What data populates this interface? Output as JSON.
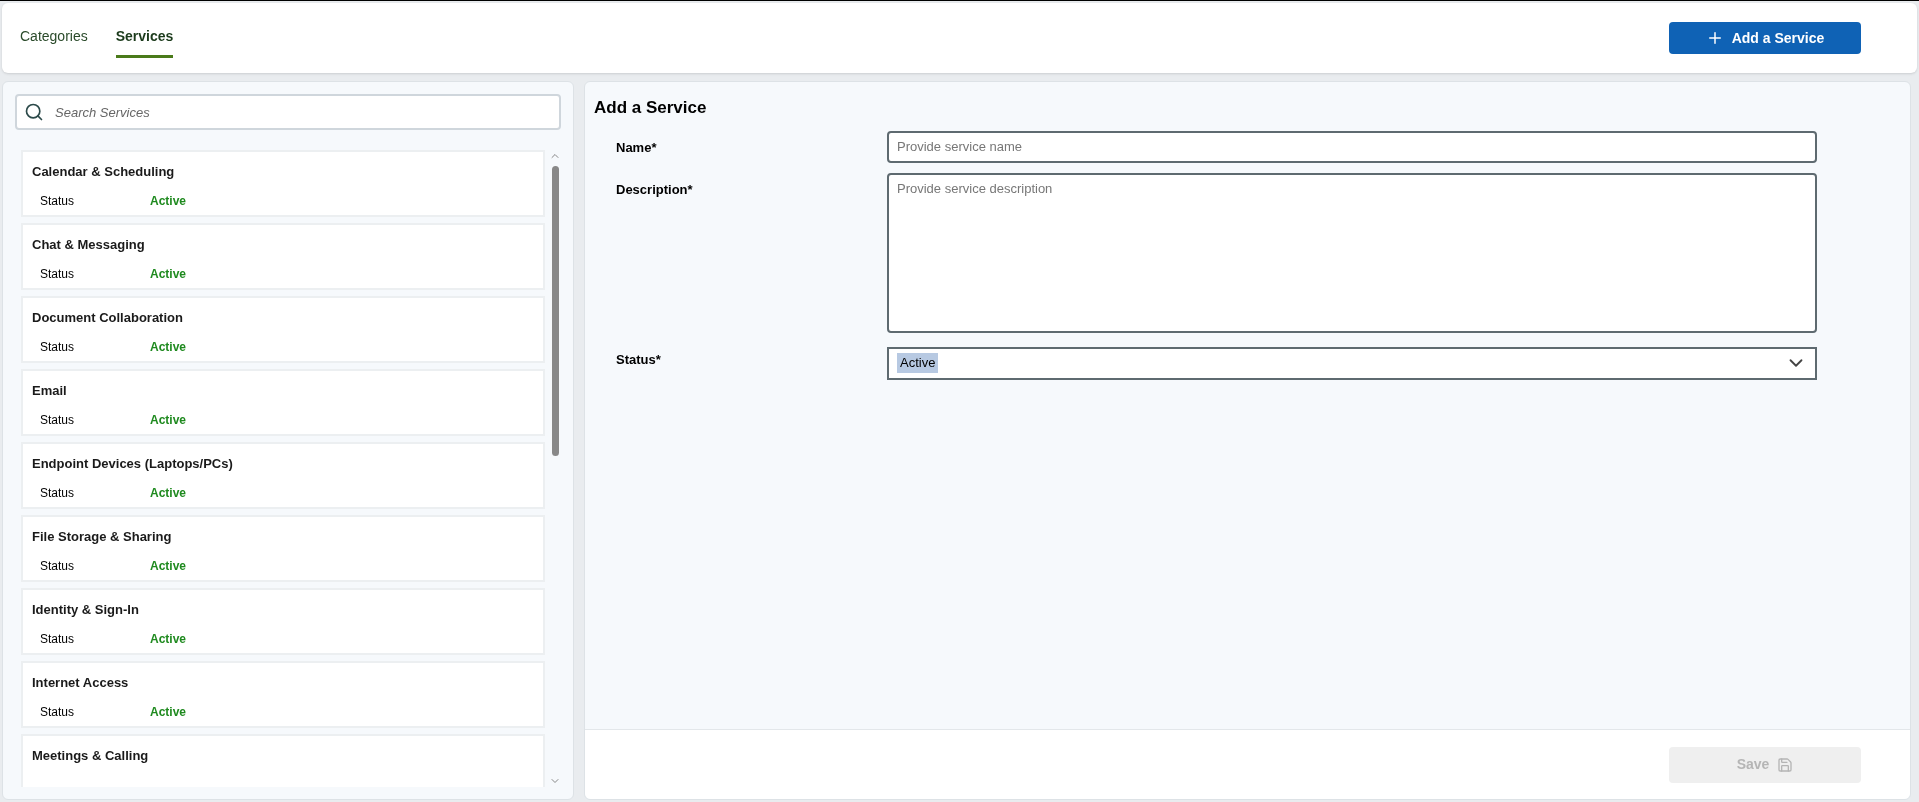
{
  "tabs": [
    {
      "label": "Categories",
      "selected": false
    },
    {
      "label": "Services",
      "selected": true
    }
  ],
  "add_button": {
    "label": "Add a Service"
  },
  "search": {
    "placeholder": "Search Services"
  },
  "services": [
    {
      "name": "Calendar & Scheduling",
      "status_label": "Status",
      "status": "Active"
    },
    {
      "name": "Chat & Messaging",
      "status_label": "Status",
      "status": "Active"
    },
    {
      "name": "Document Collaboration",
      "status_label": "Status",
      "status": "Active"
    },
    {
      "name": "Email",
      "status_label": "Status",
      "status": "Active"
    },
    {
      "name": "Endpoint Devices (Laptops/PCs)",
      "status_label": "Status",
      "status": "Active"
    },
    {
      "name": "File Storage & Sharing",
      "status_label": "Status",
      "status": "Active"
    },
    {
      "name": "Identity & Sign-In",
      "status_label": "Status",
      "status": "Active"
    },
    {
      "name": "Internet Access",
      "status_label": "Status",
      "status": "Active"
    },
    {
      "name": "Meetings & Calling"
    }
  ],
  "form": {
    "title": "Add a Service",
    "fields": [
      {
        "kind": "text",
        "label": "Name*",
        "placeholder": "Provide service name"
      },
      {
        "kind": "textarea",
        "label": "Description*",
        "placeholder": "Provide service description"
      },
      {
        "kind": "select",
        "label": "Status*",
        "value": "Active"
      }
    ],
    "save_button": {
      "label": "Save",
      "disabled": true
    }
  }
}
